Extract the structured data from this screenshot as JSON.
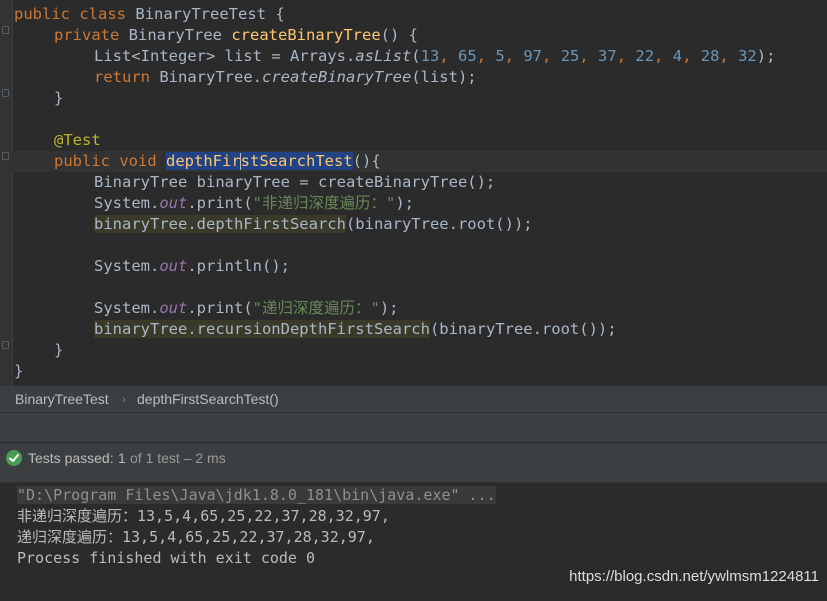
{
  "editor": {
    "lines": [
      {
        "seg": [
          "public",
          "class",
          "BinaryTreeTest {"
        ]
      },
      {
        "seg": [
          "private",
          "BinaryTree",
          "createBinaryTree",
          "() {"
        ]
      },
      {
        "seg": [
          "List<Integer> list = Arrays.",
          "asList",
          "(",
          "13",
          ", ",
          "65",
          ", ",
          "5",
          ", ",
          "97",
          ", ",
          "25",
          ", ",
          "37",
          ", ",
          "22",
          ", ",
          "4",
          ", ",
          "28",
          ", ",
          "32",
          ");"
        ]
      },
      {
        "seg": [
          "return",
          "BinaryTree.",
          "createBinaryTree",
          "(list);"
        ]
      },
      {
        "seg": [
          "}"
        ]
      },
      {
        "seg": []
      },
      {
        "seg": [
          "@Test"
        ]
      },
      {
        "seg": [
          "public",
          "void",
          "depthFir",
          "stSearchTest",
          "(){"
        ]
      },
      {
        "seg": [
          "BinaryTree binaryTree = createBinaryTree();"
        ]
      },
      {
        "seg": [
          "System.",
          "out",
          ".print(",
          "\"非递归深度遍历：\"",
          ");"
        ]
      },
      {
        "seg": [
          "binaryTree.depthFirstSearch",
          "(binaryTree.root());"
        ]
      },
      {
        "seg": []
      },
      {
        "seg": [
          "System.",
          "out",
          ".println();"
        ]
      },
      {
        "seg": []
      },
      {
        "seg": [
          "System.",
          "out",
          ".print(",
          "\"递归深度遍历：\"",
          ");"
        ]
      },
      {
        "seg": [
          "binaryTree.recursionDepthFirstSearch",
          "(binaryTree.root());"
        ]
      },
      {
        "seg": [
          "}"
        ]
      },
      {
        "seg": [
          "}"
        ]
      }
    ]
  },
  "breadcrumb": {
    "class_name": "BinaryTreeTest",
    "separator": "›",
    "method_name": "depthFirstSearchTest()"
  },
  "status": {
    "label": "Tests passed:",
    "count": "1",
    "rest": "of 1 test – 2 ms"
  },
  "console": {
    "command": "\"D:\\Program Files\\Java\\jdk1.8.0_181\\bin\\java.exe\" ...",
    "out1": "非递归深度遍历：13,5,4,65,25,22,37,28,32,97,",
    "out2": "递归深度遍历：13,5,4,65,25,22,37,28,32,97,",
    "finish": "Process finished with exit code 0"
  },
  "watermark": "https://blog.csdn.net/ywlmsm1224811",
  "colors": {
    "keyword": "#cc7832",
    "method": "#ffc66d",
    "number": "#6897bb",
    "string": "#6a8759",
    "static_field": "#9876aa",
    "annotation": "#bbb529",
    "selection": "#214283",
    "pass": "#499c54"
  }
}
